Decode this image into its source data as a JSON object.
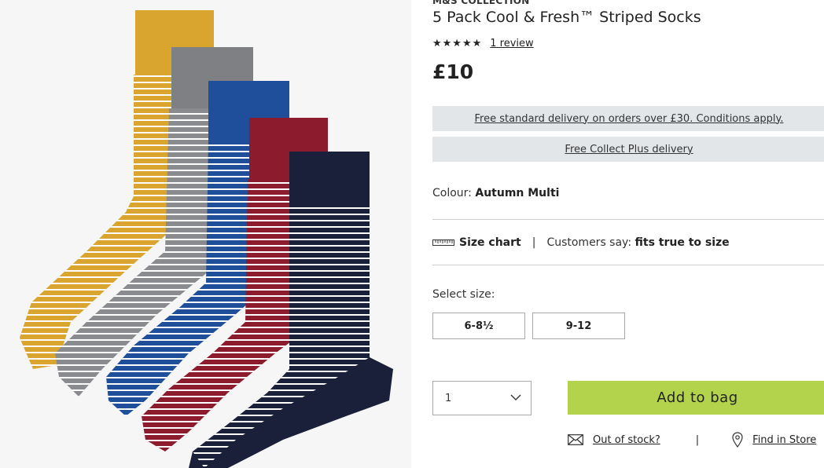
{
  "product": {
    "brand": "M&S COLLECTION",
    "title": "5 Pack Cool & Fresh™ Striped Socks",
    "stars": "★★★★★",
    "rating_value": 5,
    "review_link": "1 review",
    "price": "£10"
  },
  "delivery": {
    "standard": "Free standard delivery on orders over £30. Conditions apply.",
    "collect": "Free Collect Plus delivery"
  },
  "colour": {
    "label": "Colour:",
    "value": "Autumn Multi"
  },
  "fit": {
    "size_chart": "Size chart",
    "separator": "|",
    "customers_say": "Customers say:",
    "fit_value": "fits true to size"
  },
  "sizes": {
    "label": "Select size:",
    "options": [
      "6-8½",
      "9-12"
    ]
  },
  "purchase": {
    "quantity": "1",
    "add_to_bag": "Add to bag"
  },
  "footer_links": {
    "out_of_stock": "Out of stock?",
    "separator": "|",
    "find_in_store": "Find in Store"
  },
  "colors": {
    "add_to_bag_bg": "#b4d34c",
    "banner_bg": "#e3e6e9",
    "sock_mustard": "#d9a52f",
    "sock_grey": "#7f8084",
    "sock_blue": "#1f4f9a",
    "sock_red": "#8d1b2e",
    "sock_navy": "#1a1f3a"
  }
}
